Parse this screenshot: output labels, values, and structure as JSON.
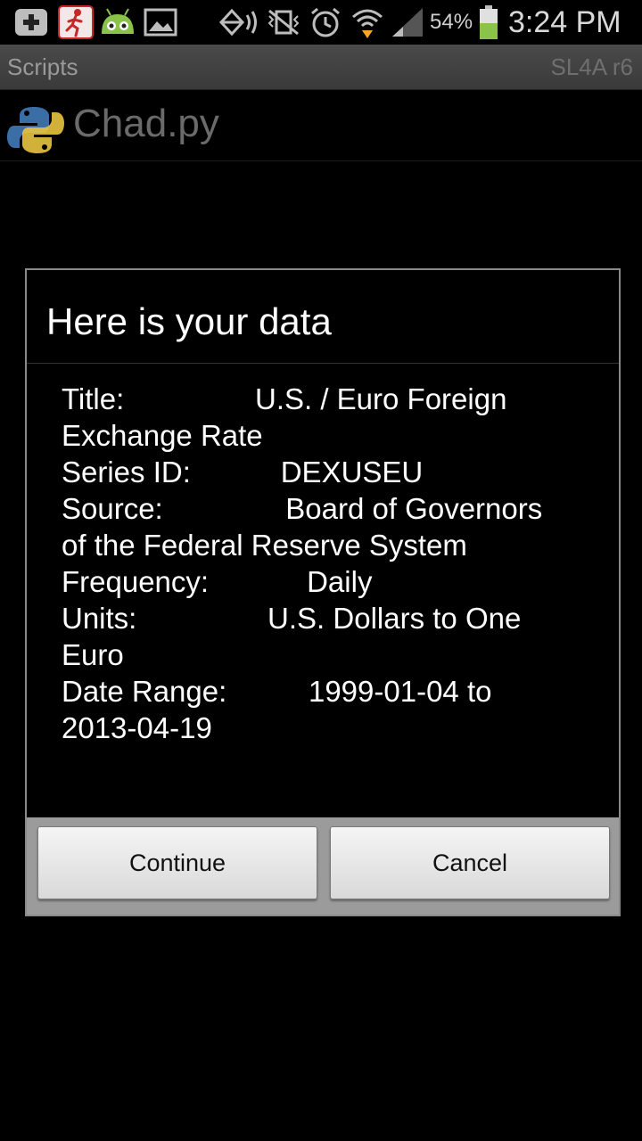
{
  "status_bar": {
    "battery_percent": "54%",
    "time": "3:24 PM",
    "battery_color": "#8bc34a",
    "icons": [
      "add-box-icon",
      "runner-app-icon",
      "android-bot-icon",
      "gallery-icon",
      "nfc-icon",
      "vibrate-off-icon",
      "alarm-icon",
      "wifi-icon",
      "signal-icon",
      "battery-icon"
    ]
  },
  "title_bar": {
    "title": "Scripts",
    "version": "SL4A r6"
  },
  "script_list": {
    "items": [
      {
        "name": "Chad.py",
        "icon": "python-icon"
      }
    ]
  },
  "dialog": {
    "title": "Here is your data",
    "lines": [
      "Title:                U.S. / Euro Foreign",
      "Exchange Rate",
      "Series ID:           DEXUSEU",
      "Source:               Board of Governors",
      "of the Federal Reserve System",
      "Frequency:            Daily",
      "Units:                U.S. Dollars to One",
      "Euro",
      "Date Range:          1999-01-04 to",
      "2013-04-19"
    ],
    "buttons": {
      "continue": "Continue",
      "cancel": "Cancel"
    }
  }
}
